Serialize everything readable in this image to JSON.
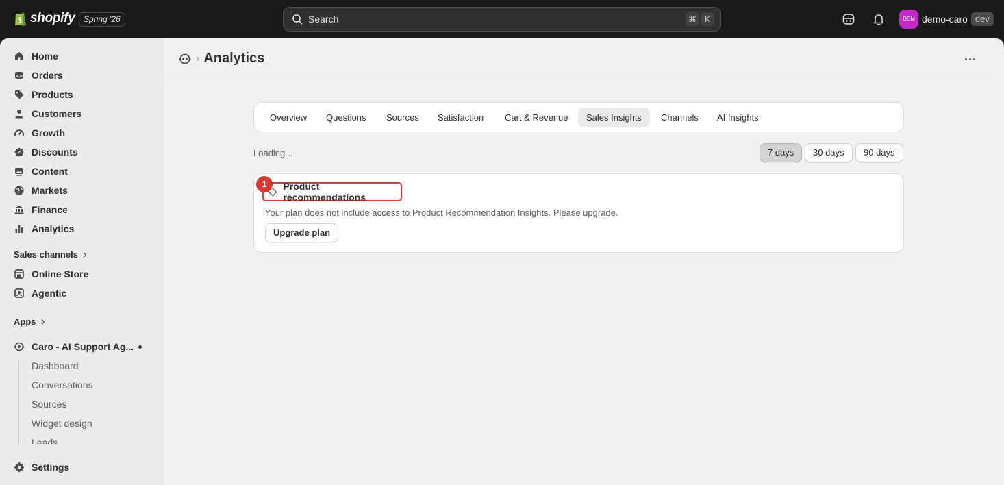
{
  "topbar": {
    "logo_text": "shopify",
    "release_badge": "Spring '26",
    "search_label": "Search",
    "shortcut_keys": [
      "⌘",
      "K"
    ],
    "avatar_initials": "DEM",
    "store_name": "demo-caro",
    "env_badge": "dev",
    "avatar_color": "#c327c8"
  },
  "sidebar": {
    "items": [
      {
        "label": "Home",
        "icon": "home-icon"
      },
      {
        "label": "Orders",
        "icon": "inbox-icon"
      },
      {
        "label": "Products",
        "icon": "tag-icon"
      },
      {
        "label": "Customers",
        "icon": "person-icon"
      },
      {
        "label": "Growth",
        "icon": "gauge-icon"
      },
      {
        "label": "Discounts",
        "icon": "discount-icon"
      },
      {
        "label": "Content",
        "icon": "content-icon"
      },
      {
        "label": "Markets",
        "icon": "globe-icon"
      },
      {
        "label": "Finance",
        "icon": "bank-icon"
      },
      {
        "label": "Analytics",
        "icon": "bar-chart-icon"
      }
    ],
    "sales_channels_label": "Sales channels",
    "channels": [
      {
        "label": "Online Store",
        "icon": "store-icon"
      },
      {
        "label": "Agentic",
        "icon": "agentic-icon"
      }
    ],
    "apps_label": "Apps",
    "app_name": "Caro - AI Support Ag...",
    "app_subitems": [
      "Dashboard",
      "Conversations",
      "Sources",
      "Widget design",
      "Leads"
    ],
    "settings_label": "Settings"
  },
  "page": {
    "title": "Analytics"
  },
  "tabs": [
    "Overview",
    "Questions",
    "Sources",
    "Satisfaction",
    "Cart & Revenue",
    "Sales Insights",
    "Channels",
    "AI Insights"
  ],
  "active_tab": "Sales Insights",
  "status_text": "Loading...",
  "ranges": [
    "7 days",
    "30 days",
    "90 days"
  ],
  "active_range": "7 days",
  "card": {
    "title": "Product recommendations",
    "message": "Your plan does not include access to Product Recommendation Insights. Please upgrade.",
    "button_label": "Upgrade plan",
    "step_marker": "1",
    "highlight_color": "#d93a2f"
  }
}
